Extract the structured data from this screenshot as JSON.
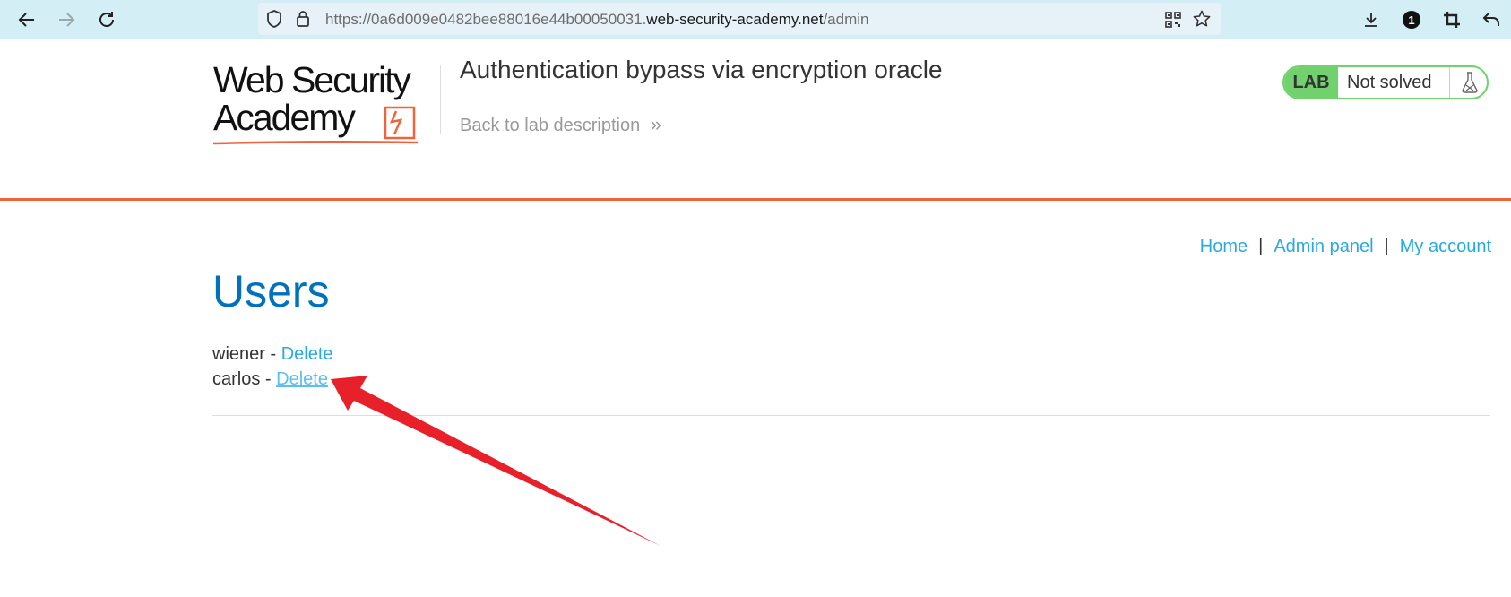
{
  "browser": {
    "url_prefix": "https://0a6d009e0482bee88016e44b00050031.",
    "url_domain": "web-security-academy.net",
    "url_path": "/admin",
    "notification_count": "1"
  },
  "header": {
    "logo_line1": "Web Security",
    "logo_line2": "Academy",
    "lab_title": "Authentication bypass via encryption oracle",
    "back_link": "Back to lab description",
    "back_link_chevrons": "»",
    "badge_label": "LAB",
    "badge_status": "Not solved"
  },
  "nav": {
    "home": "Home",
    "separator": "|",
    "admin_panel": "Admin panel",
    "my_account": "My account"
  },
  "main": {
    "title": "Users",
    "users": [
      {
        "name": "wiener",
        "dash": "-",
        "action": "Delete"
      },
      {
        "name": "carlos",
        "dash": "-",
        "action": "Delete"
      }
    ]
  },
  "colors": {
    "accent_orange": "#f0643c",
    "link_blue": "#29a9e1",
    "title_blue": "#0071bc",
    "lab_green": "#70d16d",
    "annotation_red": "#e8202a"
  },
  "icons": [
    "back-icon",
    "forward-icon",
    "reload-icon",
    "shield-icon",
    "lock-icon",
    "qr-icon",
    "star-icon",
    "download-icon",
    "badge-icon",
    "crop-icon",
    "undo-icon",
    "flask-icon"
  ]
}
